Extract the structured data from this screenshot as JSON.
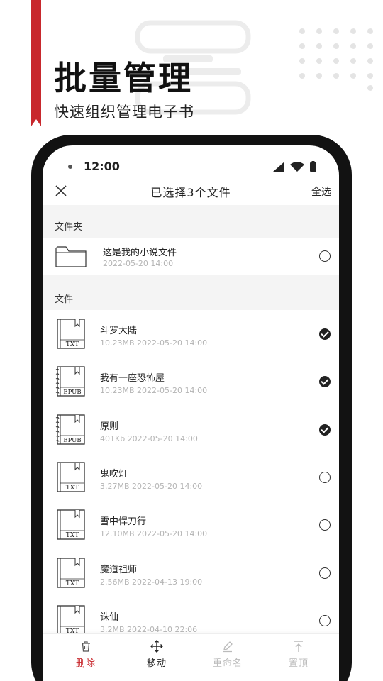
{
  "hero": {
    "title": "批量管理",
    "subtitle": "快速组织管理电子书"
  },
  "status_bar": {
    "time": "12:00"
  },
  "top_bar": {
    "title": "已选择3个文件",
    "select_all": "全选"
  },
  "sections": {
    "folders": "文件夹",
    "files": "文件"
  },
  "folders": [
    {
      "name": "这是我的小说文件",
      "meta": "2022-05-20 14:00",
      "checked": false
    }
  ],
  "files": [
    {
      "name": "斗罗大陆",
      "meta": "10.23MB 2022-05-20 14:00",
      "format": "TXT",
      "checked": true
    },
    {
      "name": "我有一座恐怖屋",
      "meta": "10.23MB 2022-05-20 14:00",
      "format": "EPUB",
      "checked": true
    },
    {
      "name": "原则",
      "meta": "401Kb 2022-05-20 14:00",
      "format": "EPUB",
      "checked": true
    },
    {
      "name": "鬼吹灯",
      "meta": "3.27MB 2022-05-20 14:00",
      "format": "TXT",
      "checked": false
    },
    {
      "name": "雪中悍刀行",
      "meta": "12.10MB 2022-05-20 14:00",
      "format": "TXT",
      "checked": false
    },
    {
      "name": "魔道祖师",
      "meta": "2.56MB 2022-04-13 19:00",
      "format": "TXT",
      "checked": false
    },
    {
      "name": "诛仙",
      "meta": "3.2MB 2022-04-10 22:06",
      "format": "TXT",
      "checked": false
    }
  ],
  "bottom_bar": {
    "delete": "删除",
    "move": "移动",
    "rename": "重命名",
    "pin": "置顶"
  },
  "colors": {
    "accent_red": "#c8282d",
    "active_tab": "#c8282d",
    "enabled_tab": "#222222",
    "disabled_tab": "#bbbbbb",
    "meta_text": "#b4b4b4",
    "section_bg": "#f4f4f4"
  }
}
